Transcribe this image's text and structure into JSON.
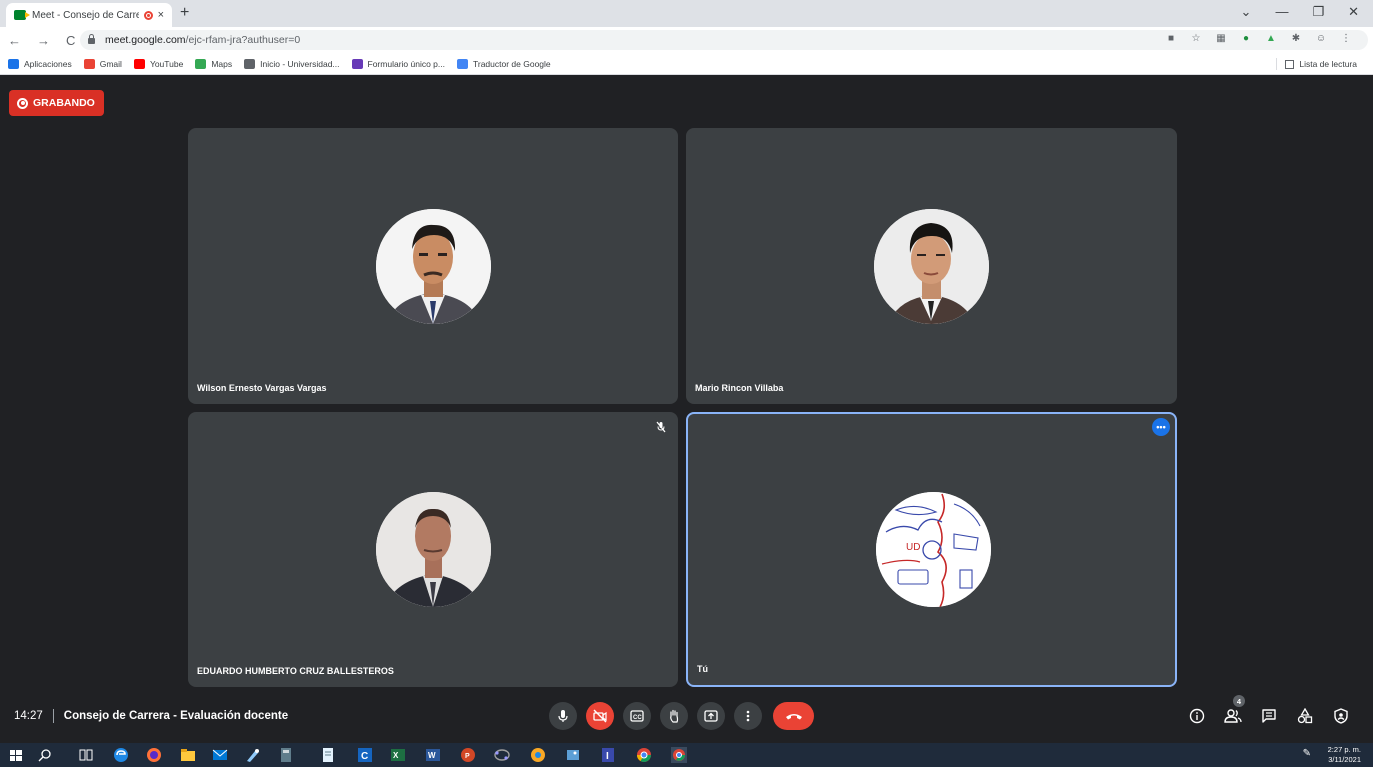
{
  "browser": {
    "tab_title": "Meet - Consejo de Carrera -",
    "tab_close": "×",
    "new_tab": "+",
    "window_controls": [
      "⌄",
      "—",
      "❐",
      "✕"
    ],
    "nav": {
      "back": "←",
      "forward": "→",
      "reload": "C"
    },
    "url_host": "meet.google.com",
    "url_path": "/ejc-rfam-jra?authuser=0",
    "extensions": [
      "camera-icon",
      "star-icon",
      "grid-icon",
      "check-icon",
      "drive-icon",
      "puzzle-icon",
      "profile-icon",
      "kebab-icon"
    ],
    "bookmarks": [
      {
        "label": "Aplicaciones",
        "icon": "apps-grid-icon",
        "color": "#1a73e8"
      },
      {
        "label": "Gmail",
        "icon": "gmail-icon",
        "color": "#ea4335"
      },
      {
        "label": "YouTube",
        "icon": "youtube-icon",
        "color": "#ff0000"
      },
      {
        "label": "Maps",
        "icon": "maps-icon",
        "color": "#34a853"
      },
      {
        "label": "Inicio - Universidad...",
        "icon": "university-icon",
        "color": "#5f6368"
      },
      {
        "label": "Formulario único p...",
        "icon": "form-icon",
        "color": "#673ab7"
      },
      {
        "label": "Traductor de Google",
        "icon": "translate-icon",
        "color": "#4285f4"
      }
    ],
    "reading_list": "Lista de lectura"
  },
  "meet": {
    "recording_label": "GRABANDO",
    "participants": [
      {
        "name": "Wilson Ernesto Vargas Vargas",
        "avatar": "photo-man-suit"
      },
      {
        "name": "Mario Rincon Villaba",
        "avatar": "photo-man-young"
      },
      {
        "name": "EDUARDO HUMBERTO CRUZ BALLESTEROS",
        "avatar": "photo-man-blurred",
        "muted": true
      },
      {
        "name": "Tú",
        "avatar": "ud-logo",
        "logo_text": "UD",
        "highlighted": true
      }
    ],
    "time": "14:27",
    "meeting_title": "Consejo de Carrera - Evaluación docente",
    "people_count": "4",
    "controls": [
      "mic-icon",
      "camera-off-icon",
      "captions-icon",
      "raise-hand-icon",
      "present-icon",
      "more-options-icon",
      "hang-up-icon"
    ],
    "right_controls": [
      "info-icon",
      "people-icon",
      "chat-icon",
      "activities-icon",
      "host-controls-icon"
    ],
    "colors": {
      "accent": "#1a73e8",
      "danger": "#ea4335",
      "tile": "#3c4043",
      "background": "#202124",
      "highlight": "#8ab4f8"
    }
  },
  "taskbar": {
    "time": "2:27 p. m.",
    "date": "3/11/2021",
    "apps": [
      "windows-start-icon",
      "search-icon",
      "task-view-icon",
      "edge-icon",
      "firefox-icon",
      "file-explorer-icon",
      "mail-icon",
      "paint-icon",
      "calculator-icon",
      "notepad-icon",
      "c-app-icon",
      "excel-icon",
      "word-icon",
      "powerpoint-icon",
      "geogebra-icon",
      "chrome-canary-icon",
      "photos-icon",
      "i-app-icon",
      "chrome-icon",
      "chrome-active-icon"
    ]
  }
}
